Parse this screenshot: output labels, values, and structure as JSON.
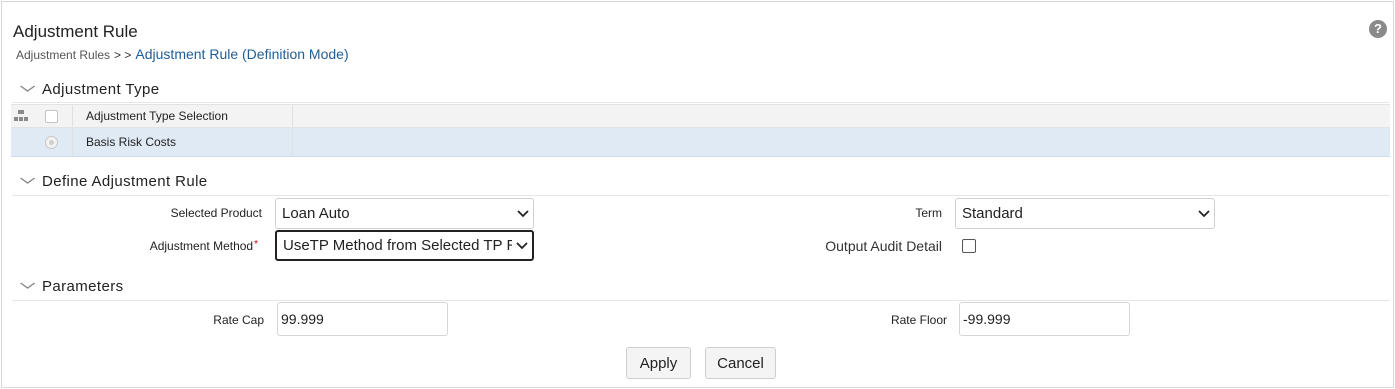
{
  "page": {
    "title": "Adjustment Rule",
    "breadcrumb": {
      "parent": "Adjustment Rules",
      "separator": "> >",
      "current": "Adjustment Rule (Definition Mode)"
    },
    "help_icon": "?"
  },
  "sections": {
    "adjustment_type": "Adjustment Type",
    "define_rule": "Define Adjustment Rule",
    "parameters": "Parameters"
  },
  "adjustment_table": {
    "column_header": "Adjustment Type Selection",
    "rows": [
      {
        "label": "Basis Risk Costs",
        "selected": false
      }
    ]
  },
  "form": {
    "selected_product": {
      "label": "Selected Product",
      "value": "Loan Auto"
    },
    "adjustment_method": {
      "label": "Adjustment Method",
      "required_mark": "*",
      "value": "UseTP Method from Selected TP Rule"
    },
    "term": {
      "label": "Term",
      "value": "Standard"
    },
    "output_audit_detail": {
      "label": "Output Audit Detail",
      "checked": false
    }
  },
  "parameters": {
    "rate_cap": {
      "label": "Rate Cap",
      "value": "99.999"
    },
    "rate_floor": {
      "label": "Rate Floor",
      "value": "-99.999"
    }
  },
  "buttons": {
    "apply": "Apply",
    "cancel": "Cancel"
  },
  "icons": {
    "help": "help-circle-icon",
    "section_toggle": "chevron-down-icon",
    "hierarchy": "hierarchy-icon",
    "dropdown": "chevron-down-icon"
  },
  "colors": {
    "link": "#1f5d99",
    "selected_row": "#dfeaf4",
    "required": "#cc0000"
  }
}
